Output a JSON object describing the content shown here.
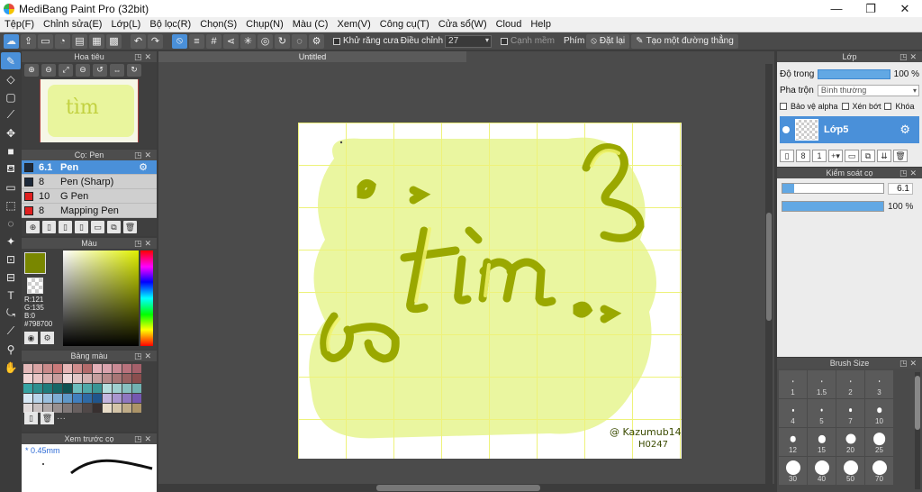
{
  "window": {
    "title": "MediBang Paint Pro (32bit)",
    "minimize": "—",
    "maximize": "❐",
    "close": "✕"
  },
  "menu": [
    "Tệp(F)",
    "Chỉnh sửa(E)",
    "Lớp(L)",
    "Bộ lọc(R)",
    "Chọn(S)",
    "Chụp(N)",
    "Màu (C)",
    "Xem(V)",
    "Công cụ(T)",
    "Cửa sổ(W)",
    "Cloud",
    "Help"
  ],
  "toolbar": {
    "antialias_label": "Khử răng cưa",
    "adjust_label": "Điều chỉnh",
    "adjust_value": "27",
    "smooth_label": "Cạnh mềm",
    "key_label": "Phím",
    "reset_label": "Đặt lại",
    "create_line_label": "Tạo một đường thẳng"
  },
  "navigator": {
    "title": "Hoa tiêu"
  },
  "brush_panel": {
    "title": "Cọ: Pen",
    "items": [
      {
        "size": "6.1",
        "name": "Pen",
        "color": "#1e2a3a",
        "selected": true
      },
      {
        "size": "8",
        "name": "Pen (Sharp)",
        "color": "#1e2a3a",
        "selected": false
      },
      {
        "size": "10",
        "name": "G Pen",
        "color": "#e02020",
        "selected": false
      },
      {
        "size": "8",
        "name": "Mapping Pen",
        "color": "#e02020",
        "selected": false
      }
    ]
  },
  "color_panel": {
    "title": "Màu",
    "main_color": "#798700",
    "r": "R:121",
    "g": "G:135",
    "b": "B:0",
    "hex": "#798700"
  },
  "palette_panel": {
    "title": "Bảng màu",
    "more": "···",
    "colors": [
      "#e3b8b8",
      "#d9a3a3",
      "#c98a8a",
      "#c97a7a",
      "#e6b6b6",
      "#cf8d8d",
      "#b36b6b",
      "#e3b0b8",
      "#d9a3ad",
      "#c98a94",
      "#b8727c",
      "#a5606a",
      "#f2d6d6",
      "#e8c4c4",
      "#d8b0b0",
      "#c79d9d",
      "#eedada",
      "#e1c6c6",
      "#d4b2b2",
      "#c59e9e",
      "#b78a8a",
      "#a87676",
      "#996262",
      "#8a4e4e",
      "#36a3a3",
      "#2e8f8f",
      "#1e7b7b",
      "#166666",
      "#0f5252",
      "#6bbdbd",
      "#4fa9a9",
      "#3a9595",
      "#b6dede",
      "#9fcfcf",
      "#88c0c0",
      "#71b1b1",
      "#d7e8f5",
      "#b9d4ea",
      "#9bc0df",
      "#7dacd4",
      "#5f98c9",
      "#417fbe",
      "#2f6aa5",
      "#20558c",
      "#c3b5de",
      "#a996cf",
      "#8f77c0",
      "#7558b1",
      "#e0dada",
      "#c8c0c0",
      "#b0a8a8",
      "#989090",
      "#807878",
      "#686060",
      "#504848",
      "#383030",
      "#e8dcc8",
      "#d4c4a8",
      "#c0ac88",
      "#ac9468"
    ]
  },
  "preview_panel": {
    "title": "Xem trước cọ",
    "size_label": "* 0.45mm"
  },
  "document": {
    "tab": "Untitled",
    "signature_line1": "@ Kazumub14",
    "signature_line2": "H0247"
  },
  "layer_panel": {
    "title": "Lớp",
    "opacity_label": "Độ trong",
    "opacity_value": "100 %",
    "blend_label": "Pha trộn",
    "blend_value": "Bình thường",
    "protect_alpha": "Bảo vệ alpha",
    "clipping": "Xén bớt",
    "lock": "Khóa",
    "layer_name": "Lớp5"
  },
  "brush_control": {
    "title": "Kiểm soát cọ",
    "size_value": "6.1",
    "size_fraction": 0.12,
    "opacity_value": "100 %",
    "opacity_fraction": 1.0
  },
  "brush_size": {
    "title": "Brush Size",
    "cells": [
      "1",
      "1.5",
      "2",
      "3",
      "4",
      "5",
      "7",
      "10",
      "12",
      "15",
      "20",
      "25",
      "30",
      "40",
      "50",
      "70"
    ]
  }
}
